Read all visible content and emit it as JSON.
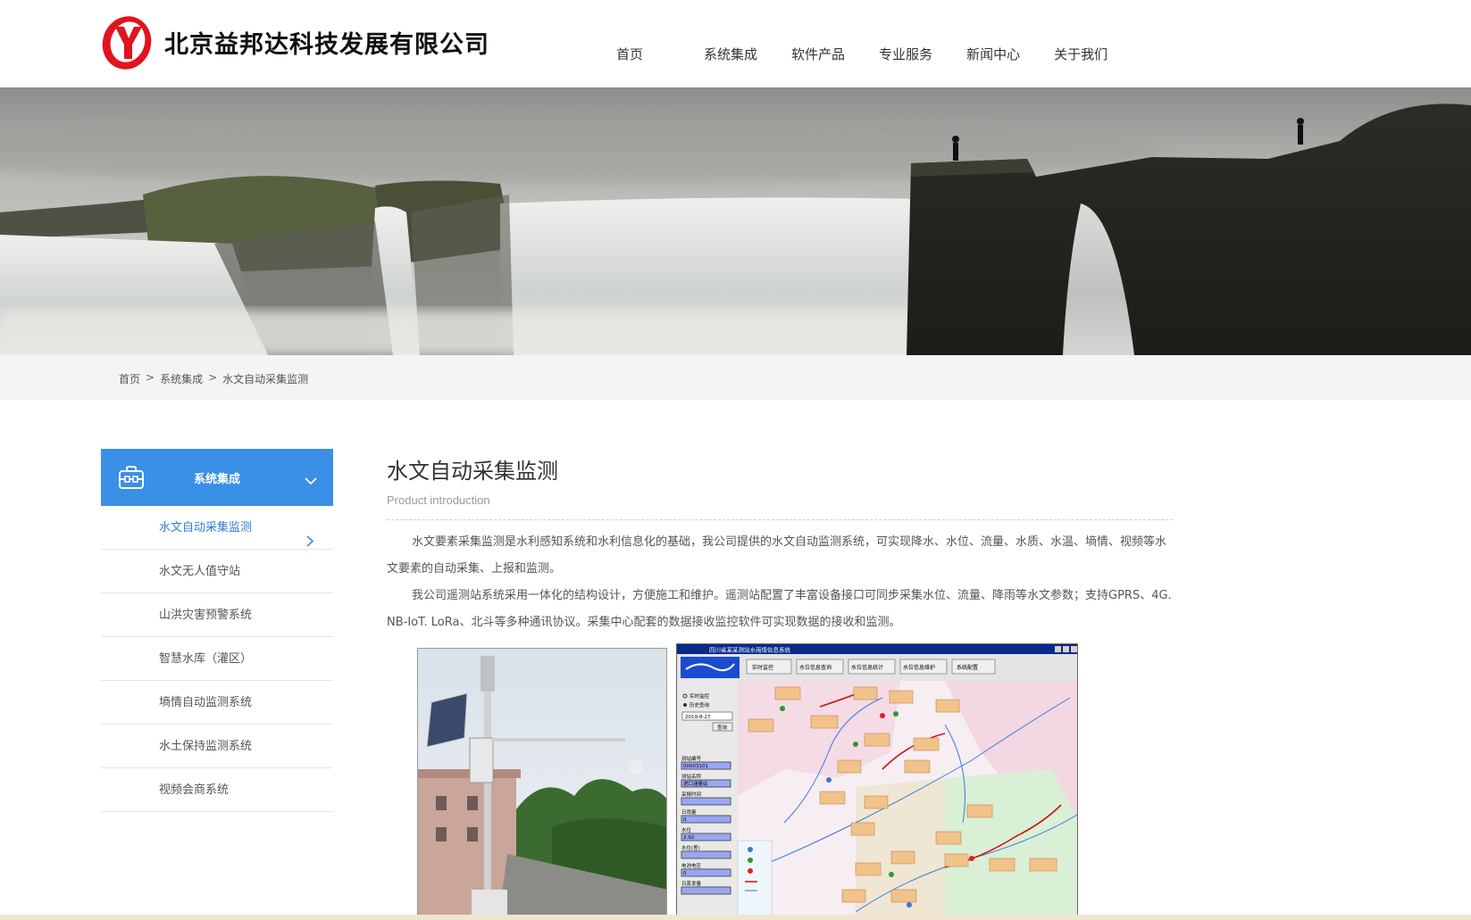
{
  "header": {
    "company_name": "北京益邦达科技发展有限公司",
    "logo_letter": "Y",
    "nav": [
      "首页",
      "系统集成",
      "软件产品",
      "专业服务",
      "新闻中心",
      "关于我们"
    ]
  },
  "breadcrumb": [
    "首页",
    "系统集成",
    "水文自动采集监测"
  ],
  "breadcrumb_sep": ">",
  "sidebar": {
    "title": "系统集成",
    "items": [
      {
        "label": "水文自动采集监测",
        "active": true
      },
      {
        "label": "水文无人值守站",
        "active": false
      },
      {
        "label": "山洪灾害预警系统",
        "active": false
      },
      {
        "label": "智慧水库（灌区）",
        "active": false
      },
      {
        "label": "墒情自动监测系统",
        "active": false
      },
      {
        "label": "水土保持监测系统",
        "active": false
      },
      {
        "label": "视频会商系统",
        "active": false
      }
    ]
  },
  "main": {
    "title": "水文自动采集监测",
    "subtitle": "Product introduction",
    "paragraphs": [
      "水文要素采集监测是水利感知系统和水利信息化的基础，我公司提供的水文自动监测系统，可实现降水、水位、流量、水质、水温、墒情、视频等水文要素的自动采集、上报和监测。",
      "我公司遥测站系统采用一体化的结构设计，方便施工和维护。遥测站配置了丰富设备接口可同步采集水位、流量、降雨等水文参数；支持GPRS、4G. NB-IoT. LoRa、北斗等多种通讯协议。采集中心配套的数据接收监控软件可实现数据的接收和监测。"
    ]
  },
  "software_window": {
    "title": "四川省某某测站水雨情信息系统",
    "toolbar": [
      "实时监控",
      "水位信息查询",
      "水位信息统计",
      "水位信息维护",
      "系统配置"
    ],
    "radio_options": [
      "实时监控",
      "历史查询"
    ],
    "date_value": "2019-8-27",
    "query_button": "查询",
    "fields": [
      "测站编号",
      "测站名称",
      "采报时间",
      "日雨量",
      "水位",
      "水位(差)",
      "电池电压",
      "日蒸发量"
    ],
    "field_values": [
      "00003101",
      "进口涵量站",
      "",
      "0",
      "2.92",
      "",
      "0",
      ""
    ]
  },
  "colors": {
    "accent": "#3a8fe6",
    "active_text": "#2f7fd1",
    "logo_red": "#e0141e"
  },
  "icons": {
    "sidebar_head": "briefcase-icon",
    "sidebar_toggle": "chevron-down-icon",
    "active_item": "chevron-right-icon"
  }
}
